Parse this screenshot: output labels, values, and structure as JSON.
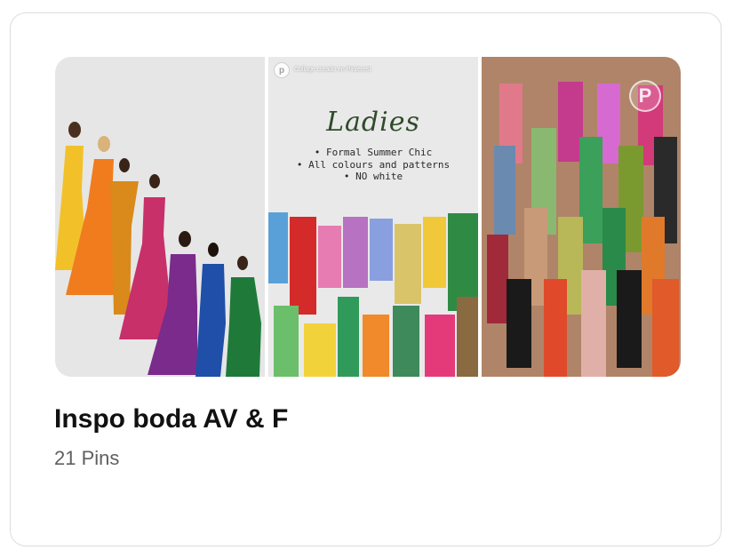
{
  "board": {
    "title": "Inspo boda AV & F",
    "pin_count": "21 Pins"
  },
  "collage": {
    "panel_2": {
      "script_title": "Ladies",
      "bullets": [
        "• Formal Summer Chic",
        "• All colours and patterns",
        "• NO white"
      ],
      "attribution": "Collage creado en Pinterest"
    }
  },
  "icons": {
    "pinterest_logo": "pinterest-icon"
  },
  "colors": {
    "title": "#111111",
    "subtitle": "#5f5f5f",
    "card_border": "#dcdcdc"
  }
}
